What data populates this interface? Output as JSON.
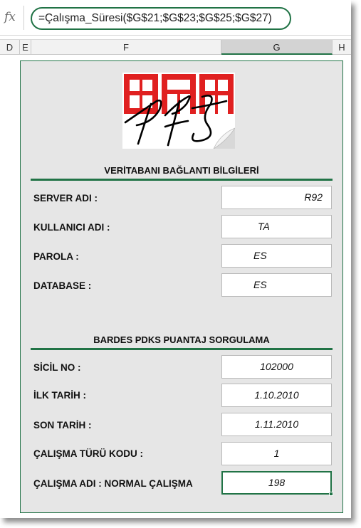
{
  "formula_bar": {
    "fx_label": "fx",
    "formula": "=Çalışma_Süresi($G$21;$G$23;$G$25;$G$27)"
  },
  "columns": [
    "D",
    "E",
    "F",
    "G",
    "H"
  ],
  "selected_column": "G",
  "logo": {
    "top_text": "BAR",
    "script_text": "PFS",
    "icon": "bardes-pfs-logo"
  },
  "connection_section": {
    "title": "VERİTABANI BAĞLANTI BİLGİLERİ",
    "rows": [
      {
        "label": "SERVER ADI :",
        "value": "R92"
      },
      {
        "label": "KULLANICI ADI :",
        "value": "TA"
      },
      {
        "label": "PAROLA :",
        "value": "ES"
      },
      {
        "label": "DATABASE :",
        "value": "ES"
      }
    ]
  },
  "query_section": {
    "title": "BARDES PDKS PUANTAJ SORGULAMA",
    "rows": [
      {
        "label": "SİCİL NO :",
        "value": "102000"
      },
      {
        "label": "İLK TARİH :",
        "value": "1.10.2010"
      },
      {
        "label": "SON TARİH :",
        "value": "1.11.2010"
      },
      {
        "label": "ÇALIŞMA TÜRÜ KODU :",
        "value": "1"
      },
      {
        "label": "ÇALIŞMA ADI : NORMAL ÇALIŞMA",
        "value": "198"
      }
    ]
  },
  "colors": {
    "accent_green": "#217346",
    "logo_red": "#e02020",
    "panel_bg": "#e6e6e6"
  }
}
